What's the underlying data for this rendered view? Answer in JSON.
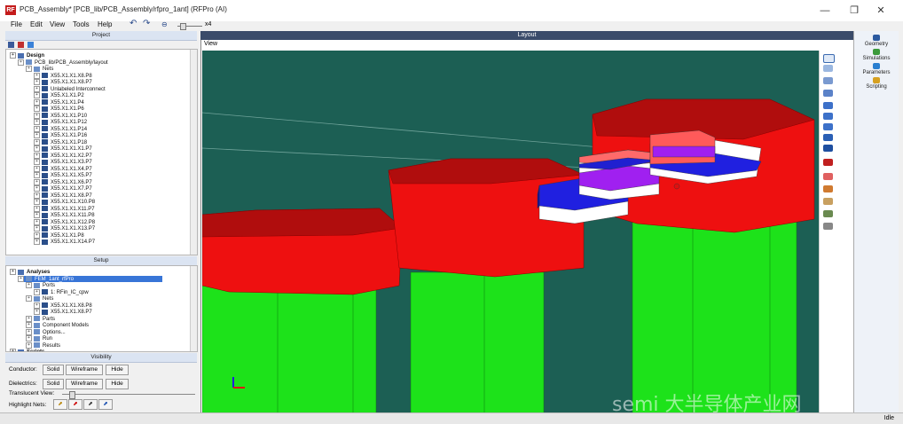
{
  "window": {
    "title": "PCB_Assembly* [PCB_lib/PCB_Assembly/rfpro_1ant] (RFPro (AI)",
    "app_icon": "RF",
    "controls": [
      "—",
      "❐",
      "✕"
    ]
  },
  "menu": {
    "items": [
      "File",
      "Edit",
      "View",
      "Tools",
      "Help"
    ],
    "zoom_value": "x4"
  },
  "project_panel": {
    "header": "Project",
    "tree": [
      {
        "label": "Design",
        "level": 0,
        "bold": true
      },
      {
        "label": "PCB_lib/PCB_Assembly/layout",
        "level": 1
      },
      {
        "label": "Nets",
        "level": 2
      },
      {
        "label": "X55.X1.X1.X8.P8",
        "level": 3
      },
      {
        "label": "X55.X1.X1.X8.P7",
        "level": 3
      },
      {
        "label": "Unlabeled Interconnect",
        "level": 3
      },
      {
        "label": "X55.X1.X1.P2",
        "level": 3
      },
      {
        "label": "X55.X1.X1.P4",
        "level": 3
      },
      {
        "label": "X55.X1.X1.P6",
        "level": 3
      },
      {
        "label": "X55.X1.X1.P10",
        "level": 3
      },
      {
        "label": "X55.X1.X1.P12",
        "level": 3
      },
      {
        "label": "X55.X1.X1.P14",
        "level": 3
      },
      {
        "label": "X55.X1.X1.P16",
        "level": 3
      },
      {
        "label": "X55.X1.X1.P18",
        "level": 3
      },
      {
        "label": "X55.X1.X1.X1.P7",
        "level": 3
      },
      {
        "label": "X55.X1.X1.X2.P7",
        "level": 3
      },
      {
        "label": "X55.X1.X1.X3.P7",
        "level": 3
      },
      {
        "label": "X55.X1.X1.X4.P7",
        "level": 3
      },
      {
        "label": "X55.X1.X1.X5.P7",
        "level": 3
      },
      {
        "label": "X55.X1.X1.X6.P7",
        "level": 3
      },
      {
        "label": "X55.X1.X1.X7.P7",
        "level": 3
      },
      {
        "label": "X55.X1.X1.X8.P7",
        "level": 3
      },
      {
        "label": "X55.X1.X1.X10.P8",
        "level": 3
      },
      {
        "label": "X55.X1.X1.X11.P7",
        "level": 3
      },
      {
        "label": "X55.X1.X1.X11.P8",
        "level": 3
      },
      {
        "label": "X55.X1.X1.X12.P8",
        "level": 3
      },
      {
        "label": "X55.X1.X1.X13.P7",
        "level": 3
      },
      {
        "label": "X55.X1.X1.P8",
        "level": 3
      },
      {
        "label": "X55.X1.X1.X14.P7",
        "level": 3
      }
    ]
  },
  "setup_panel": {
    "header": "Setup",
    "tree": [
      {
        "label": "Analyses",
        "level": 0,
        "bold": true
      },
      {
        "label": "FEM_1ant_rfPro",
        "level": 1,
        "selected": true
      },
      {
        "label": "Ports",
        "level": 2
      },
      {
        "label": "1: RFin_IC_cpw",
        "level": 3
      },
      {
        "label": "Nets",
        "level": 2
      },
      {
        "label": "X55.X1.X1.X8.P8",
        "level": 3
      },
      {
        "label": "X55.X1.X1.X8.P7",
        "level": 3
      },
      {
        "label": "Parts",
        "level": 2
      },
      {
        "label": "Component Models",
        "level": 2
      },
      {
        "label": "Options...",
        "level": 2
      },
      {
        "label": "Run",
        "level": 2
      },
      {
        "label": "Results",
        "level": 2
      },
      {
        "label": "Scripts",
        "level": 0,
        "bold": true
      }
    ]
  },
  "visibility_panel": {
    "header": "Visibility",
    "conductor_label": "Conductor:",
    "dielectrics_label": "Dielectrics:",
    "solid": "Solid",
    "wireframe": "Wireframe",
    "hide": "Hide",
    "translucent_label": "Translucent View:",
    "highlight_label": "Highlight Nets:",
    "translucent_value": 0.05
  },
  "layout_panel": {
    "header": "Layout",
    "view_menu": "View"
  },
  "right_panel": {
    "items": [
      {
        "label": "Geometry",
        "color": "#2c5aa0"
      },
      {
        "label": "Simulations",
        "color": "#3b9a3b"
      },
      {
        "label": "Parameters",
        "color": "#2a7fd0"
      },
      {
        "label": "Scripting",
        "color": "#d6a020"
      }
    ]
  },
  "status": {
    "text": "Idle"
  },
  "watermark": "semi 大半导体产业网",
  "colors": {
    "viewport_bg": "#1c5f54",
    "conductor": "#e8100e",
    "pillar": "#19e00f",
    "dielectric_purple": "#9b18e0",
    "blue_layer": "#1b1bd8"
  },
  "icons": [
    "search-icon",
    "zoom-icon",
    "fit-view-icon",
    "rotate-icon",
    "layers-icon",
    "measure-icon",
    "axis-icon"
  ]
}
